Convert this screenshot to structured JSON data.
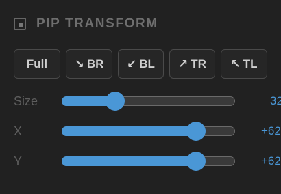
{
  "header": {
    "title": "PIP TRANSFORM",
    "icon": "picture-in-picture-icon"
  },
  "presets": [
    {
      "label": "Full",
      "arrow": ""
    },
    {
      "label": "BR",
      "arrow": "↘"
    },
    {
      "label": "BL",
      "arrow": "↙"
    },
    {
      "label": "TR",
      "arrow": "↗"
    },
    {
      "label": "TL",
      "arrow": "↖"
    }
  ],
  "sliders": {
    "size": {
      "label": "Size",
      "value_text": "32",
      "fraction": 0.31
    },
    "x": {
      "label": "X",
      "value_text": "+62",
      "fraction": 0.78
    },
    "y": {
      "label": "Y",
      "value_text": "+62",
      "fraction": 0.78
    }
  },
  "colors": {
    "accent": "#4a97d6",
    "background": "#212121"
  }
}
